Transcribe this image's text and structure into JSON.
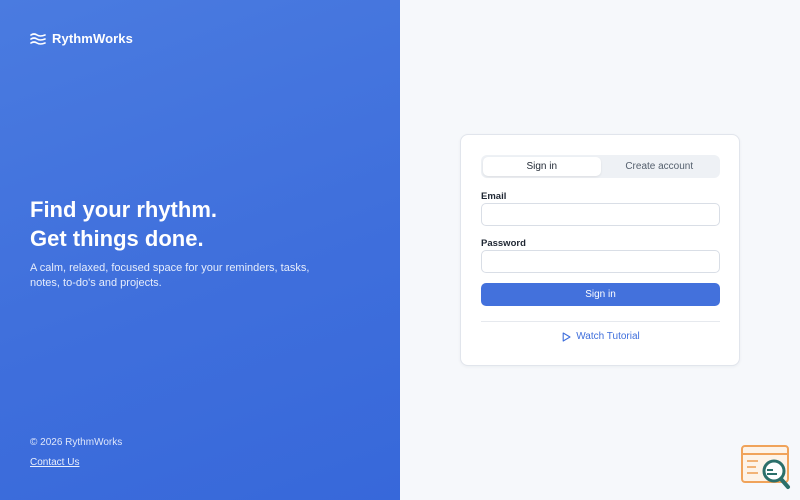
{
  "brand": {
    "name": "RythmWorks",
    "icon": "waves-icon"
  },
  "hero": {
    "headline_line1": "Find your rhythm.",
    "headline_line2": "Get things done.",
    "tagline": "A calm, relaxed, focused space for your reminders, tasks, notes, to-do's and projects."
  },
  "footer": {
    "copyright": "© 2026 RythmWorks",
    "contact": "Contact Us"
  },
  "auth": {
    "tabs": [
      {
        "label": "Sign in",
        "active": true
      },
      {
        "label": "Create account",
        "active": false
      }
    ],
    "email_label": "Email",
    "email_value": "",
    "password_label": "Password",
    "password_value": "",
    "submit_label": "Sign in",
    "tutorial_label": "Watch Tutorial",
    "tutorial_icon": "play-icon"
  },
  "colors": {
    "accent": "#3f6fdc",
    "panel": "#4371dc",
    "background": "#f6f8fb"
  },
  "corner_widget": {
    "icon": "search-app-icon"
  }
}
